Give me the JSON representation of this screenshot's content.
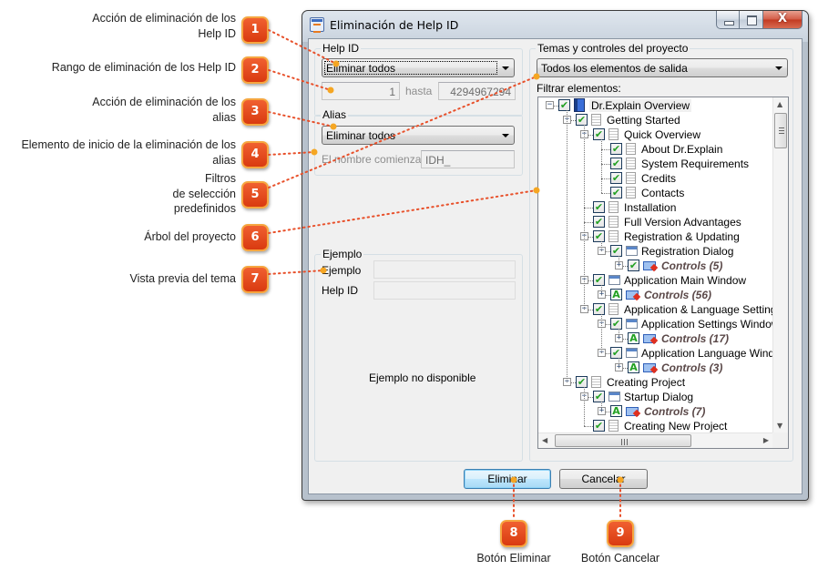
{
  "callouts": [
    {
      "number": "1",
      "label_lines": [
        "Acción de eliminación de los",
        "Help ID"
      ]
    },
    {
      "number": "2",
      "label_lines": [
        "Rango de eliminación de los Help ID"
      ]
    },
    {
      "number": "3",
      "label_lines": [
        "Acción de eliminación de los",
        "alias"
      ]
    },
    {
      "number": "4",
      "label_lines": [
        "Elemento de inicio de la eliminación de los",
        "alias"
      ]
    },
    {
      "number": "5",
      "label_lines": [
        "Filtros",
        "de selección",
        "predefinidos"
      ]
    },
    {
      "number": "6",
      "label_lines": [
        "Árbol del proyecto"
      ]
    },
    {
      "number": "7",
      "label_lines": [
        "Vista previa del tema"
      ]
    },
    {
      "number": "8",
      "label_lines": [
        "Botón Eliminar"
      ]
    },
    {
      "number": "9",
      "label_lines": [
        "Botón Cancelar"
      ]
    }
  ],
  "accent_colors": {
    "badge": "#e2461a",
    "badge_border": "#f6a640",
    "leader": "#e8502a",
    "leader_dot": "#f5a623"
  },
  "window": {
    "title": "Eliminación de Help ID",
    "icon": "dialog-app-icon",
    "controls": {
      "minimize": "minimize-icon",
      "maximize": "maximize-icon",
      "close": "X"
    }
  },
  "helpid_group": {
    "title": "Help ID",
    "action_value": "Eliminar todos",
    "range_from": "1",
    "range_to_label": "hasta",
    "range_to": "4294967294"
  },
  "alias_group": {
    "title": "Alias",
    "action_value": "Eliminar todos",
    "starts_with_label": "El nombre comienza",
    "starts_with_value": "IDH_"
  },
  "example_group": {
    "title": "Ejemplo",
    "example_label": "Ejemplo",
    "example_value": "",
    "helpid_label": "Help ID",
    "helpid_value": "",
    "empty_message": "Ejemplo no disponible"
  },
  "project_group": {
    "title": "Temas y controles del proyecto",
    "filter_preset": "Todos los elementos de salida",
    "filter_label": "Filtrar elementos:",
    "tree": [
      {
        "level": 0,
        "text": "Dr.Explain Overview",
        "icon": "book",
        "expander": "minus",
        "check": "checked"
      },
      {
        "level": 1,
        "text": "Getting Started",
        "icon": "page",
        "expander": "minus",
        "check": "checked"
      },
      {
        "level": 2,
        "text": "Quick Overview",
        "icon": "page",
        "expander": "minus",
        "check": "checked"
      },
      {
        "level": 3,
        "text": "About Dr.Explain",
        "icon": "page",
        "expander": "none",
        "check": "checked"
      },
      {
        "level": 3,
        "text": "System Requirements",
        "icon": "page",
        "expander": "none",
        "check": "checked"
      },
      {
        "level": 3,
        "text": "Credits",
        "icon": "page",
        "expander": "none",
        "check": "checked"
      },
      {
        "level": 3,
        "text": "Contacts",
        "icon": "page",
        "expander": "none",
        "check": "checked"
      },
      {
        "level": 2,
        "text": "Installation",
        "icon": "page",
        "expander": "none",
        "check": "checked"
      },
      {
        "level": 2,
        "text": "Full Version Advantages",
        "icon": "page",
        "expander": "none",
        "check": "checked"
      },
      {
        "level": 2,
        "text": "Registration & Updating",
        "icon": "page",
        "expander": "minus",
        "check": "checked"
      },
      {
        "level": 3,
        "text": "Registration Dialog",
        "icon": "window",
        "expander": "minus",
        "check": "checked"
      },
      {
        "level": 4,
        "text": "Controls (5)",
        "icon": "controls",
        "expander": "plus",
        "check": "checked"
      },
      {
        "level": 2,
        "text": "Application Main Window",
        "icon": "window",
        "expander": "minus",
        "check": "checked"
      },
      {
        "level": 3,
        "text": "Controls (56)",
        "icon": "controls",
        "expander": "plus",
        "check": "auto"
      },
      {
        "level": 2,
        "text": "Application & Language Settings",
        "icon": "page",
        "expander": "minus",
        "check": "checked"
      },
      {
        "level": 3,
        "text": "Application Settings Window",
        "icon": "window",
        "expander": "minus",
        "check": "checked"
      },
      {
        "level": 4,
        "text": "Controls (17)",
        "icon": "controls",
        "expander": "plus",
        "check": "auto"
      },
      {
        "level": 3,
        "text": "Application Language Window",
        "icon": "window",
        "expander": "minus",
        "check": "checked"
      },
      {
        "level": 4,
        "text": "Controls (3)",
        "icon": "controls",
        "expander": "plus",
        "check": "auto"
      },
      {
        "level": 1,
        "text": "Creating Project",
        "icon": "page",
        "expander": "minus",
        "check": "checked"
      },
      {
        "level": 2,
        "text": "Startup Dialog",
        "icon": "window",
        "expander": "minus",
        "check": "checked"
      },
      {
        "level": 3,
        "text": "Controls (7)",
        "icon": "controls",
        "expander": "plus",
        "check": "auto"
      },
      {
        "level": 2,
        "text": "Creating New Project",
        "icon": "page",
        "expander": "none",
        "check": "checked"
      }
    ]
  },
  "buttons": {
    "delete": "Eliminar",
    "cancel": "Cancelar"
  }
}
